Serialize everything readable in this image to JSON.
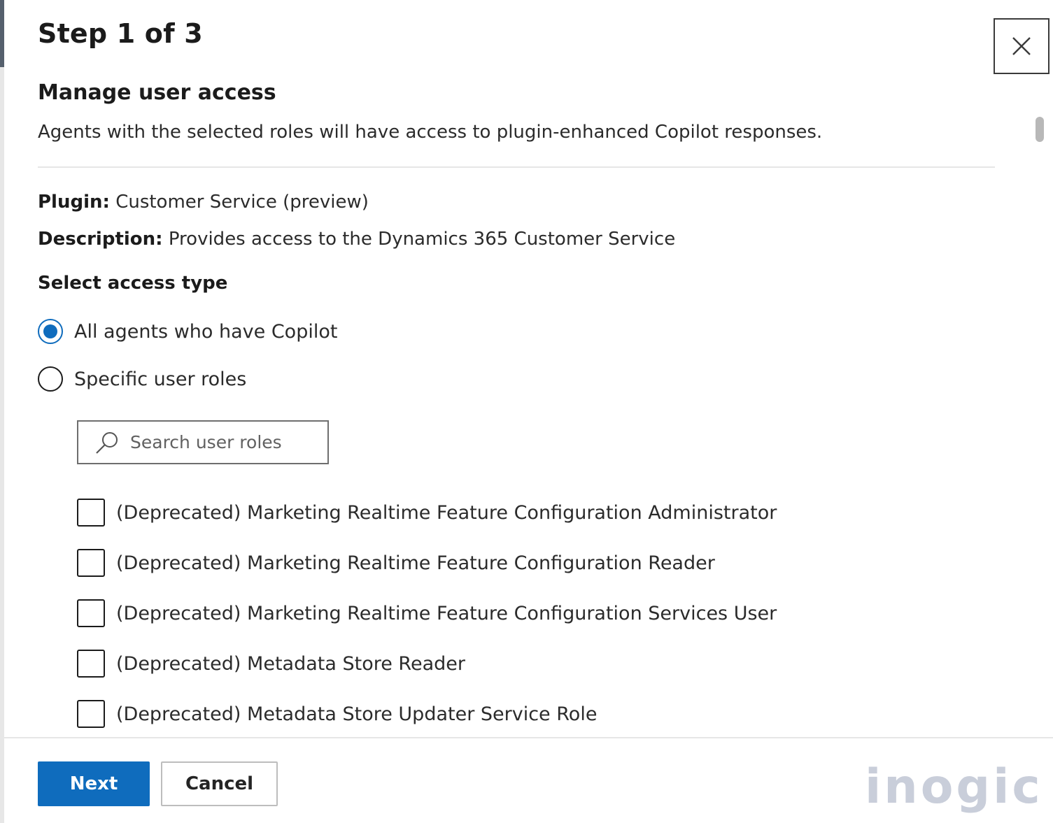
{
  "dialog": {
    "step_label": "Step 1 of 3",
    "close_icon": "close-icon"
  },
  "section": {
    "title": "Manage user access",
    "description": "Agents with the selected roles will have access to plugin-enhanced Copilot responses."
  },
  "plugin": {
    "label": "Plugin:",
    "value": "Customer Service (preview)"
  },
  "description": {
    "label": "Description:",
    "value": "Provides access to the Dynamics 365 Customer Service"
  },
  "access": {
    "heading": "Select access type",
    "options": [
      {
        "label": "All agents who have Copilot",
        "selected": true
      },
      {
        "label": "Specific user roles",
        "selected": false
      }
    ]
  },
  "search": {
    "placeholder": "Search user roles",
    "icon": "search-icon"
  },
  "roles": [
    {
      "label": "(Deprecated) Marketing Realtime Feature Configuration Administrator",
      "checked": false
    },
    {
      "label": "(Deprecated) Marketing Realtime Feature Configuration Reader",
      "checked": false
    },
    {
      "label": "(Deprecated) Marketing Realtime Feature Configuration Services User",
      "checked": false
    },
    {
      "label": "(Deprecated) Metadata Store Reader",
      "checked": false
    },
    {
      "label": "(Deprecated) Metadata Store Updater Service Role",
      "checked": false
    }
  ],
  "footer": {
    "next_label": "Next",
    "cancel_label": "Cancel"
  },
  "watermark": {
    "text": "inogic"
  },
  "colors": {
    "accent": "#0f6cbd",
    "watermark": "#c9ceda"
  }
}
